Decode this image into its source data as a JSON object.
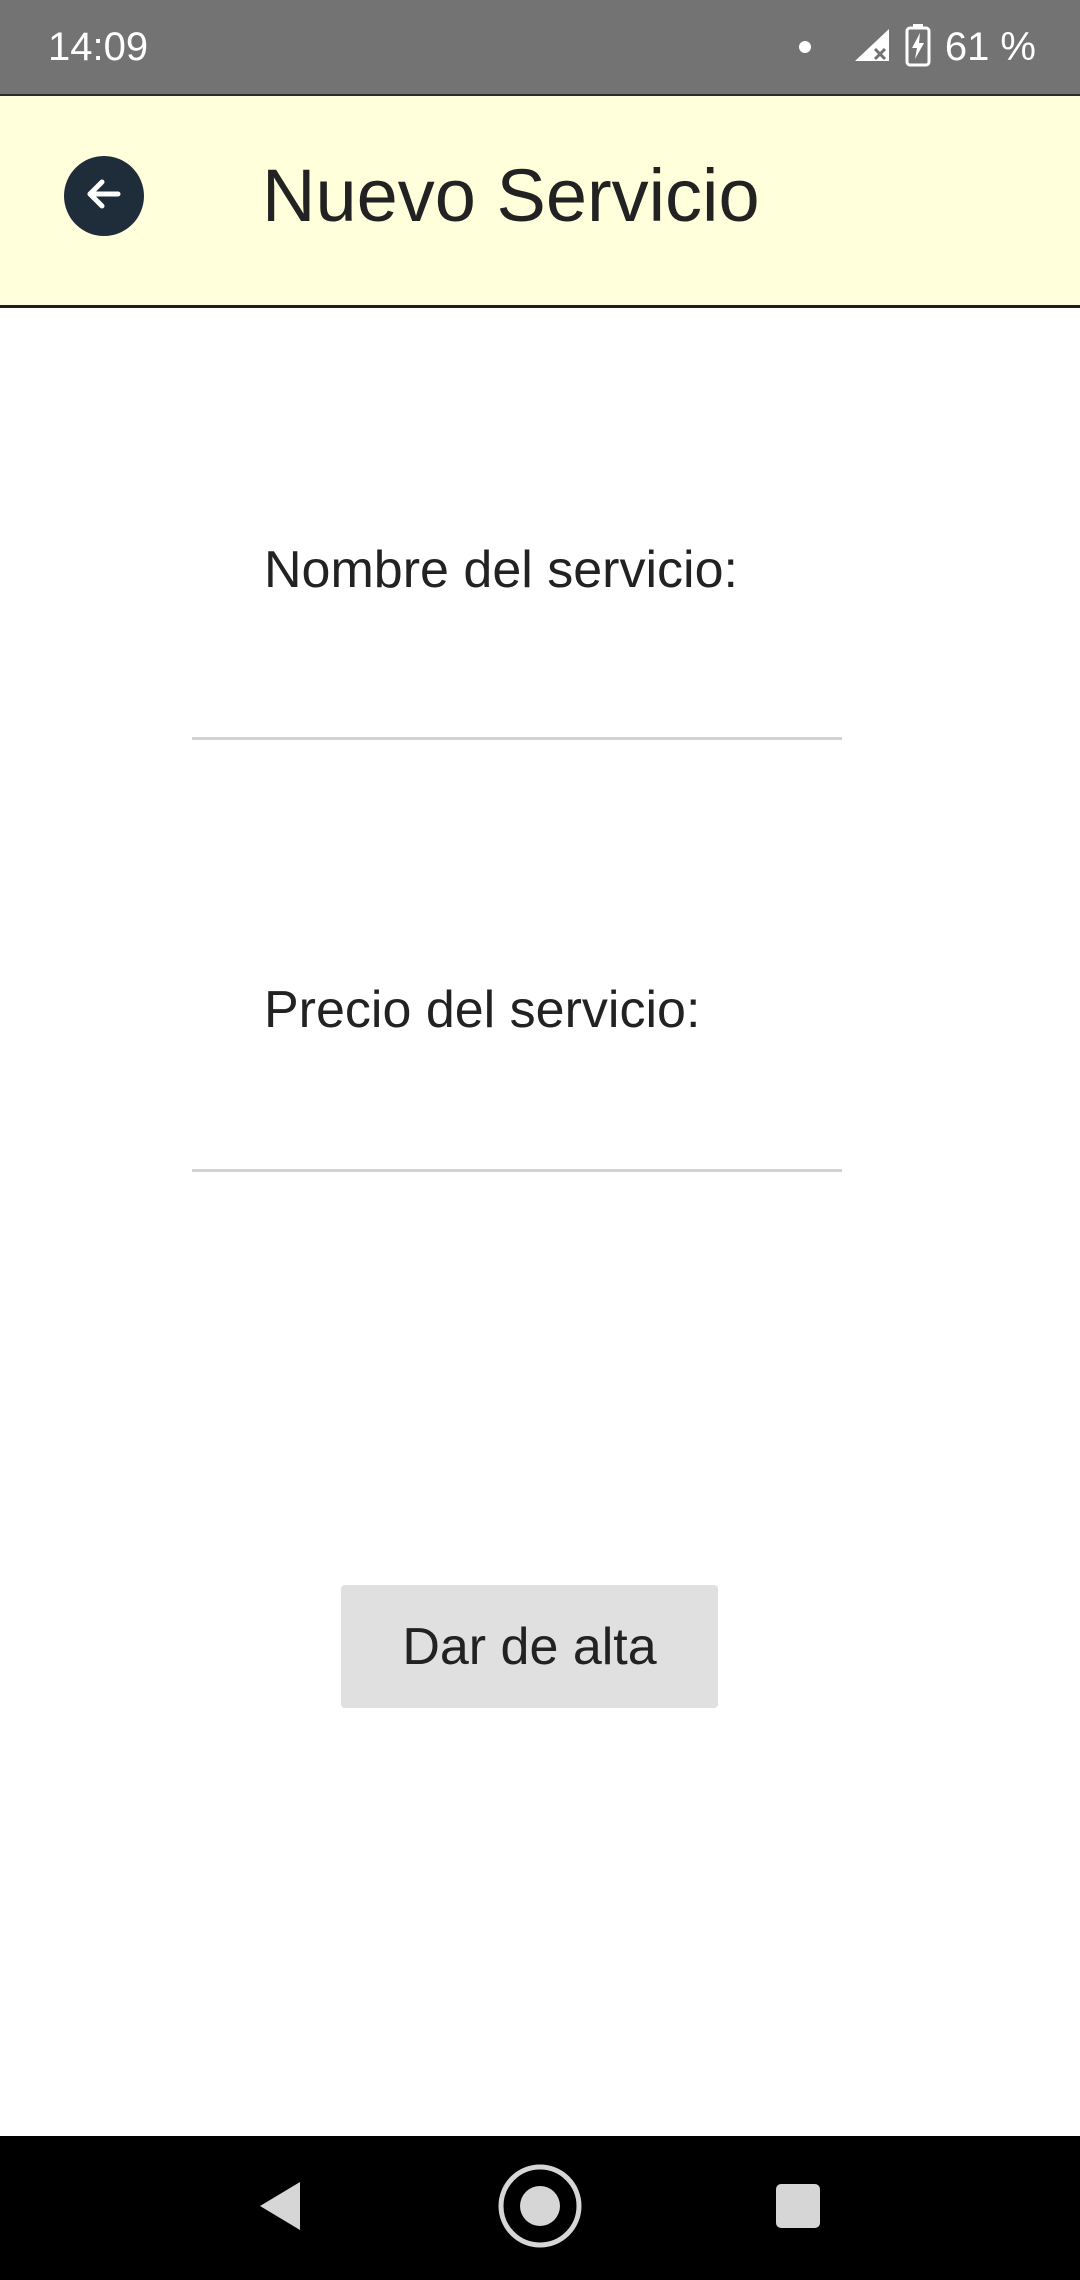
{
  "status_bar": {
    "time": "14:09",
    "battery": "61 %"
  },
  "app_bar": {
    "title": "Nuevo Servicio",
    "back_icon": "arrow-left-icon"
  },
  "form": {
    "name_label": "Nombre del servicio:",
    "name_value": "",
    "price_label": "Precio del servicio:",
    "price_value": "",
    "submit_label": "Dar de alta"
  },
  "colors": {
    "status_bar": "#737373",
    "app_bar": "#ffffdc",
    "back_button": "#1f2d3a",
    "submit_button": "#e0e0e0",
    "nav_bar": "#000000"
  },
  "nav_bar": {
    "icons": [
      "back-triangle-icon",
      "home-circle-icon",
      "recents-square-icon"
    ]
  }
}
